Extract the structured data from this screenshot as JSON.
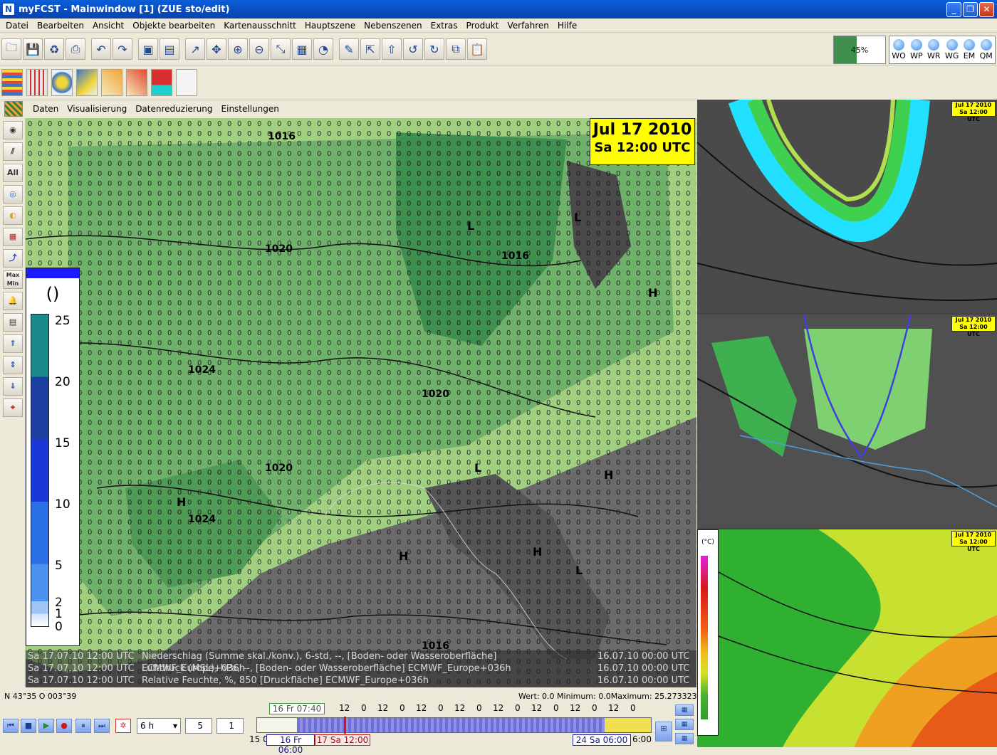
{
  "window": {
    "title": "myFCST - Mainwindow [1] (ZUE sto/edit)",
    "app_icon": "N"
  },
  "menu": [
    "Datei",
    "Bearbeiten",
    "Ansicht",
    "Objekte bearbeiten",
    "Kartenausschnitt",
    "Hauptszene",
    "Nebenszenen",
    "Extras",
    "Produkt",
    "Verfahren",
    "Hilfe"
  ],
  "toolbar": {
    "icons": [
      "open-icon",
      "save-icon",
      "recycle-icon",
      "print-icon",
      "undo-icon",
      "redo-icon",
      "image-export-icon",
      "layout-icon",
      "pointer-icon",
      "pan-icon",
      "zoom-in-icon",
      "zoom-out-icon",
      "unzoom-icon",
      "dictionary-icon",
      "distance-km-icon",
      "edit-pencil-icon",
      "select-icon",
      "up-arrow-icon",
      "undo-arrow-icon",
      "redo-arrow-icon",
      "copy-icon",
      "paste-icon"
    ],
    "progress_label": "45%",
    "progress_value": 0.45,
    "models": [
      "WO",
      "WP",
      "WR",
      "WG",
      "EM",
      "QM"
    ]
  },
  "map_menu": [
    "Daten",
    "Visualisierung",
    "Datenreduzierung",
    "Einstellungen"
  ],
  "left_tools": {
    "all_label": "All",
    "maxmin_label": "Max Min"
  },
  "main_map": {
    "date_line1": "Jul 17 2010",
    "date_line2": "Sa 12:00 UTC",
    "legend_unit": "()",
    "legend_ticks": [
      "25",
      "20",
      "15",
      "10",
      "5",
      "2",
      "1",
      "0"
    ],
    "isobars": [
      "1016",
      "1020",
      "1016",
      "1024",
      "1020",
      "1020",
      "1024",
      "1016"
    ],
    "pressure_centers": [
      "L",
      "L",
      "H",
      "H",
      "L",
      "H",
      "H",
      "H",
      "L"
    ],
    "info_lines": [
      {
        "time": "Sa 17.07.10 12:00 UTC",
        "desc": "Niederschlag (Summe skal./konv.), 6-std, --, [Boden- oder Wasseroberfläche] ECMWF_Europe+036h",
        "run": "16.07.10 00:00 UTC"
      },
      {
        "time": "Sa 17.07.10 12:00 UTC",
        "desc": "Luftdruck (MSL), hPa, --, [Boden- oder Wasseroberfläche] ECMWF_Europe+036h",
        "run": "16.07.10 00:00 UTC"
      },
      {
        "time": "Sa 17.07.10 12:00 UTC",
        "desc": "Relative Feuchte, %, 850 [Druckfläche] ECMWF_Europe+036h",
        "run": "16.07.10 00:00 UTC"
      }
    ]
  },
  "status": {
    "coords": "N 43°35 O 003°39",
    "value_stats": "Wert: 0.0 Minimum: 0.0Maximum: 25.273323"
  },
  "bottom": {
    "step_select": "6 h",
    "spin1": "5",
    "spin2": "1",
    "current_time_top": "16 Fr 07:40",
    "tick_labels": [
      "12",
      "0",
      "12",
      "0",
      "12",
      "0",
      "12",
      "0",
      "12",
      "0",
      "12",
      "0",
      "12",
      "0",
      "12",
      "0"
    ],
    "left_label": "15 0",
    "range_start": "16 Fr 06:00",
    "current": "17 Sa 12:00",
    "range_end": "24 Sa 06:00",
    "right_label": "6:00"
  },
  "right_panels": [
    {
      "date_line1": "Jul 17 2010",
      "date_line2": "Sa 12:00 UTC"
    },
    {
      "date_line1": "Jul 17 2010",
      "date_line2": "Sa 12:00 UTC"
    },
    {
      "date_line1": "Jul 17 2010",
      "date_line2": "Sa 12:00 UTC",
      "legend_unit": "(°C)"
    }
  ]
}
